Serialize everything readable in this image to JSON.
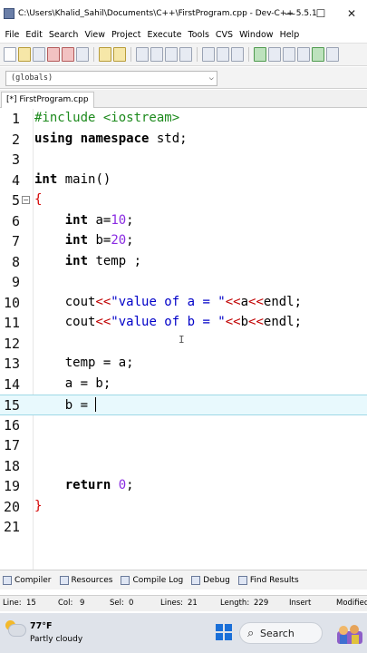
{
  "window": {
    "title": "C:\\Users\\Khalid_Sahil\\Documents\\C++\\FirstProgram.cpp - Dev-C++ 5.5.1",
    "controls": [
      "—",
      "☐",
      "✕"
    ]
  },
  "menu": [
    "File",
    "Edit",
    "Search",
    "View",
    "Project",
    "Execute",
    "Tools",
    "CVS",
    "Window",
    "Help"
  ],
  "scope": {
    "selected": "(globals)"
  },
  "file_tab": {
    "label": "[*] FirstProgram.cpp"
  },
  "editor": {
    "lines": [
      {
        "n": "1"
      },
      {
        "n": "2"
      },
      {
        "n": "3"
      },
      {
        "n": "4"
      },
      {
        "n": "5"
      },
      {
        "n": "6"
      },
      {
        "n": "7"
      },
      {
        "n": "8"
      },
      {
        "n": "9"
      },
      {
        "n": "10"
      },
      {
        "n": "11"
      },
      {
        "n": "12"
      },
      {
        "n": "13"
      },
      {
        "n": "14"
      },
      {
        "n": "15"
      },
      {
        "n": "16"
      },
      {
        "n": "17"
      },
      {
        "n": "18"
      },
      {
        "n": "19"
      },
      {
        "n": "20"
      },
      {
        "n": "21"
      }
    ],
    "code": {
      "l1_prep": "#include <iostream>",
      "l2_kw1": "using",
      "l2_kw2": "namespace",
      "l2_rest": " std;",
      "l4_kw": "int",
      "l4_rest": " main()",
      "l5_brace": "{",
      "l6_kw": "int",
      "l6_a": " a=",
      "l6_num": "10",
      "l6_end": ";",
      "l7_kw": "int",
      "l7_a": " b=",
      "l7_num": "20",
      "l7_end": ";",
      "l8_kw": "int",
      "l8_rest": " temp ;",
      "l10_a": "cout",
      "l10_op1": "<<",
      "l10_str": "\"value of a = \"",
      "l10_op2": "<<",
      "l10_v": "a",
      "l10_op3": "<<",
      "l10_end": "endl;",
      "l11_a": "cout",
      "l11_op1": "<<",
      "l11_str": "\"value of b = \"",
      "l11_op2": "<<",
      "l11_v": "b",
      "l11_op3": "<<",
      "l11_end": "endl;",
      "l13": "temp = a;",
      "l14": "a = b;",
      "l15": "b = ",
      "l19_kw": "return",
      "l19_sp": " ",
      "l19_num": "0",
      "l19_end": ";",
      "l20_brace": "}"
    },
    "current_line": 15
  },
  "bottom_tabs": [
    "Compiler",
    "Resources",
    "Compile Log",
    "Debug",
    "Find Results"
  ],
  "status": {
    "line_label": "Line:",
    "line_val": "15",
    "col_label": "Col:",
    "col_val": "9",
    "sel_label": "Sel:",
    "sel_val": "0",
    "lines_label": "Lines:",
    "lines_val": "21",
    "length_label": "Length:",
    "length_val": "229",
    "mode": "Insert",
    "state": "Modified"
  },
  "taskbar": {
    "temperature": "77°F",
    "condition": "Partly cloudy",
    "search_label": "Search"
  },
  "colors": {
    "current_line_bg": "#e8f9fd",
    "preprocessor": "#1d8a1d",
    "string": "#0000c8",
    "number": "#8a2be2",
    "operator": "#c00000",
    "start_button": "#1a6fd8"
  }
}
